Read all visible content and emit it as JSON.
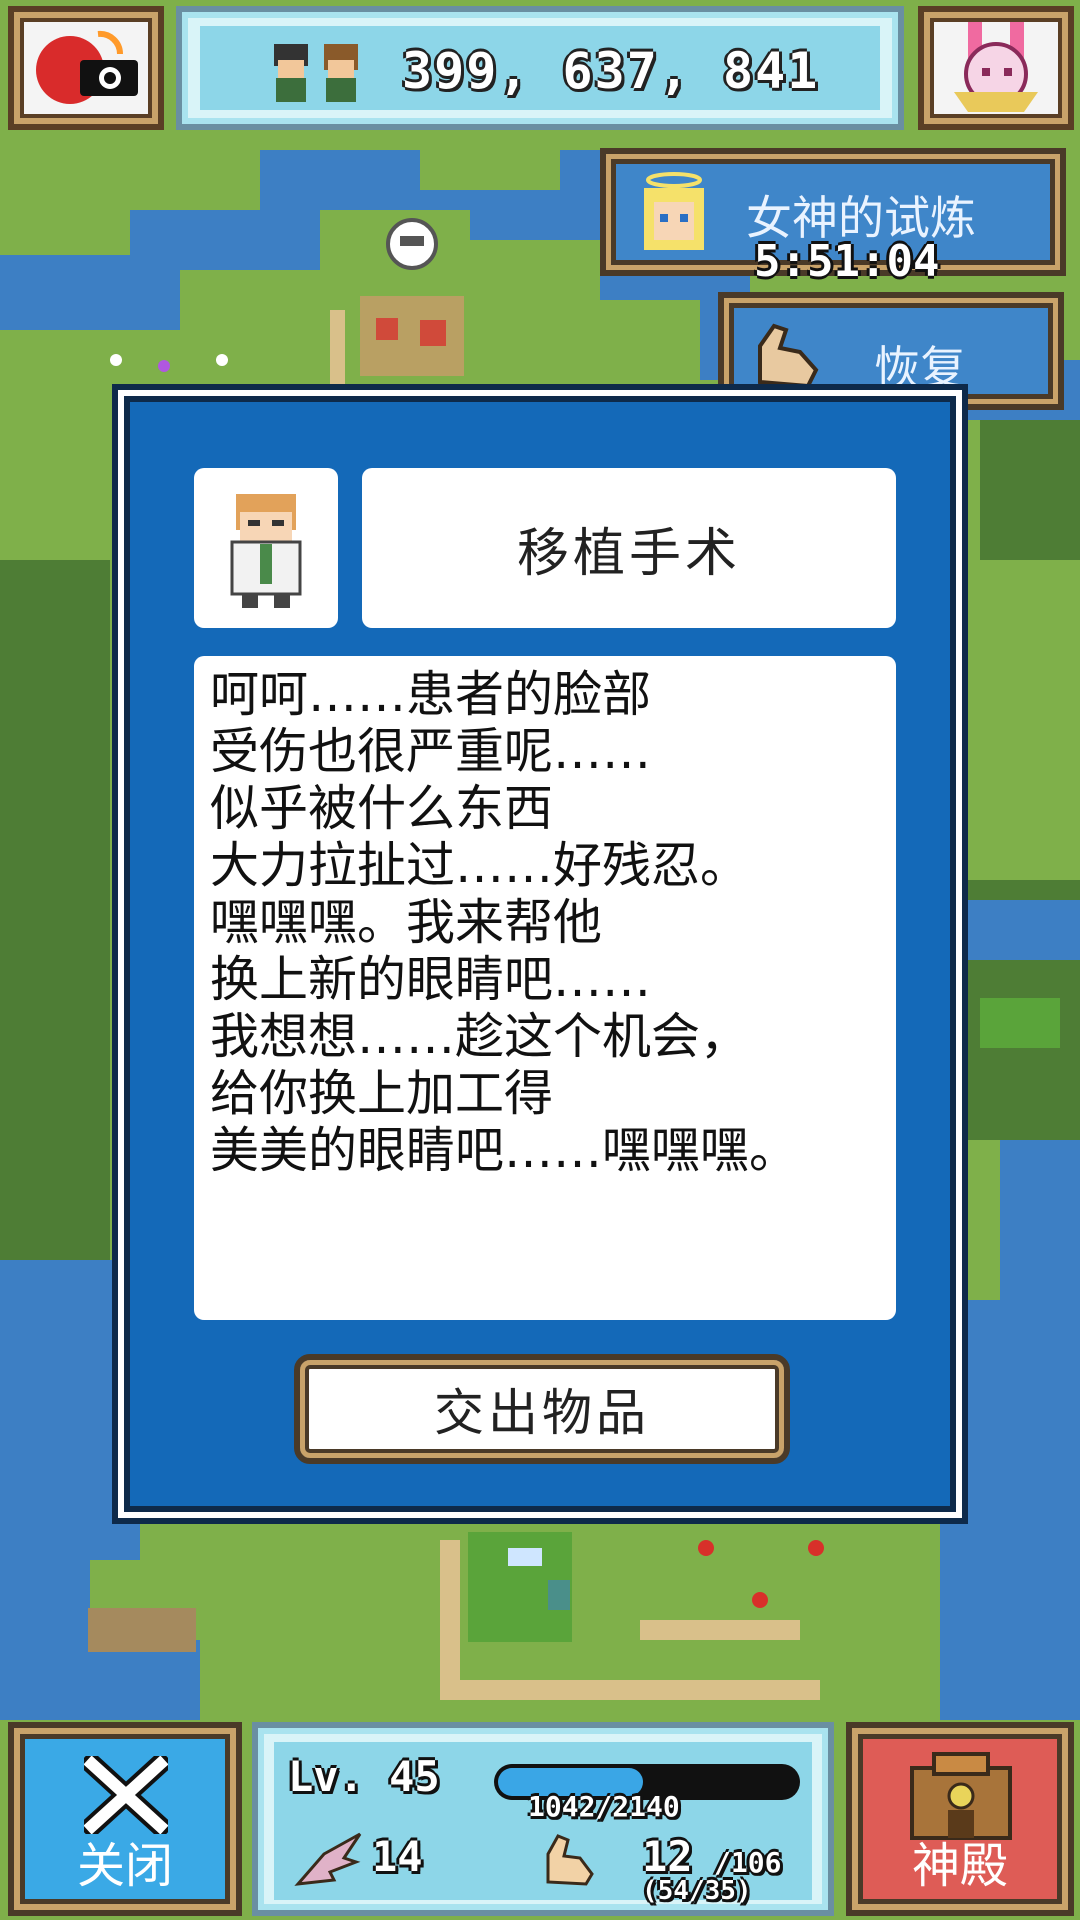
{
  "header": {
    "population": "399, 637, 841"
  },
  "trial": {
    "label": "女神的试炼",
    "timer": "5:51:04"
  },
  "recover": {
    "label": "恢复"
  },
  "dialog": {
    "title": "移植手术",
    "message_lines": [
      "呵呵……患者的脸部",
      "受伤也很严重呢……",
      "似乎被什么东西",
      "大力拉扯过……好残忍。",
      "嘿嘿嘿。我来帮他",
      "换上新的眼睛吧……",
      "我想想……趁这个机会，",
      "给你换上加工得",
      "美美的眼睛吧……嘿嘿嘿。"
    ],
    "action_label": "交出物品"
  },
  "bottom": {
    "close_label": "关闭",
    "temple_label": "神殿",
    "level": "Lv. 45",
    "xp_text": "1042/2140",
    "xp_current": 1042,
    "xp_max": 2140,
    "speed": "14",
    "power": "12",
    "power_max": "/106",
    "power_base": "(54/35)"
  },
  "colors": {
    "dialog_blue": "#1469b8",
    "close_blue": "#3aa9e6",
    "temple_red": "#de5c56",
    "panel_cyan": "#8dd6e8"
  },
  "icons": [
    "camera-icon",
    "bunny-mascot-icon",
    "villager-pair-icon",
    "goddess-icon",
    "muscle-arm-icon",
    "scientist-portrait-icon",
    "close-x-icon",
    "temple-icon",
    "speed-wing-icon",
    "power-arm-icon"
  ]
}
